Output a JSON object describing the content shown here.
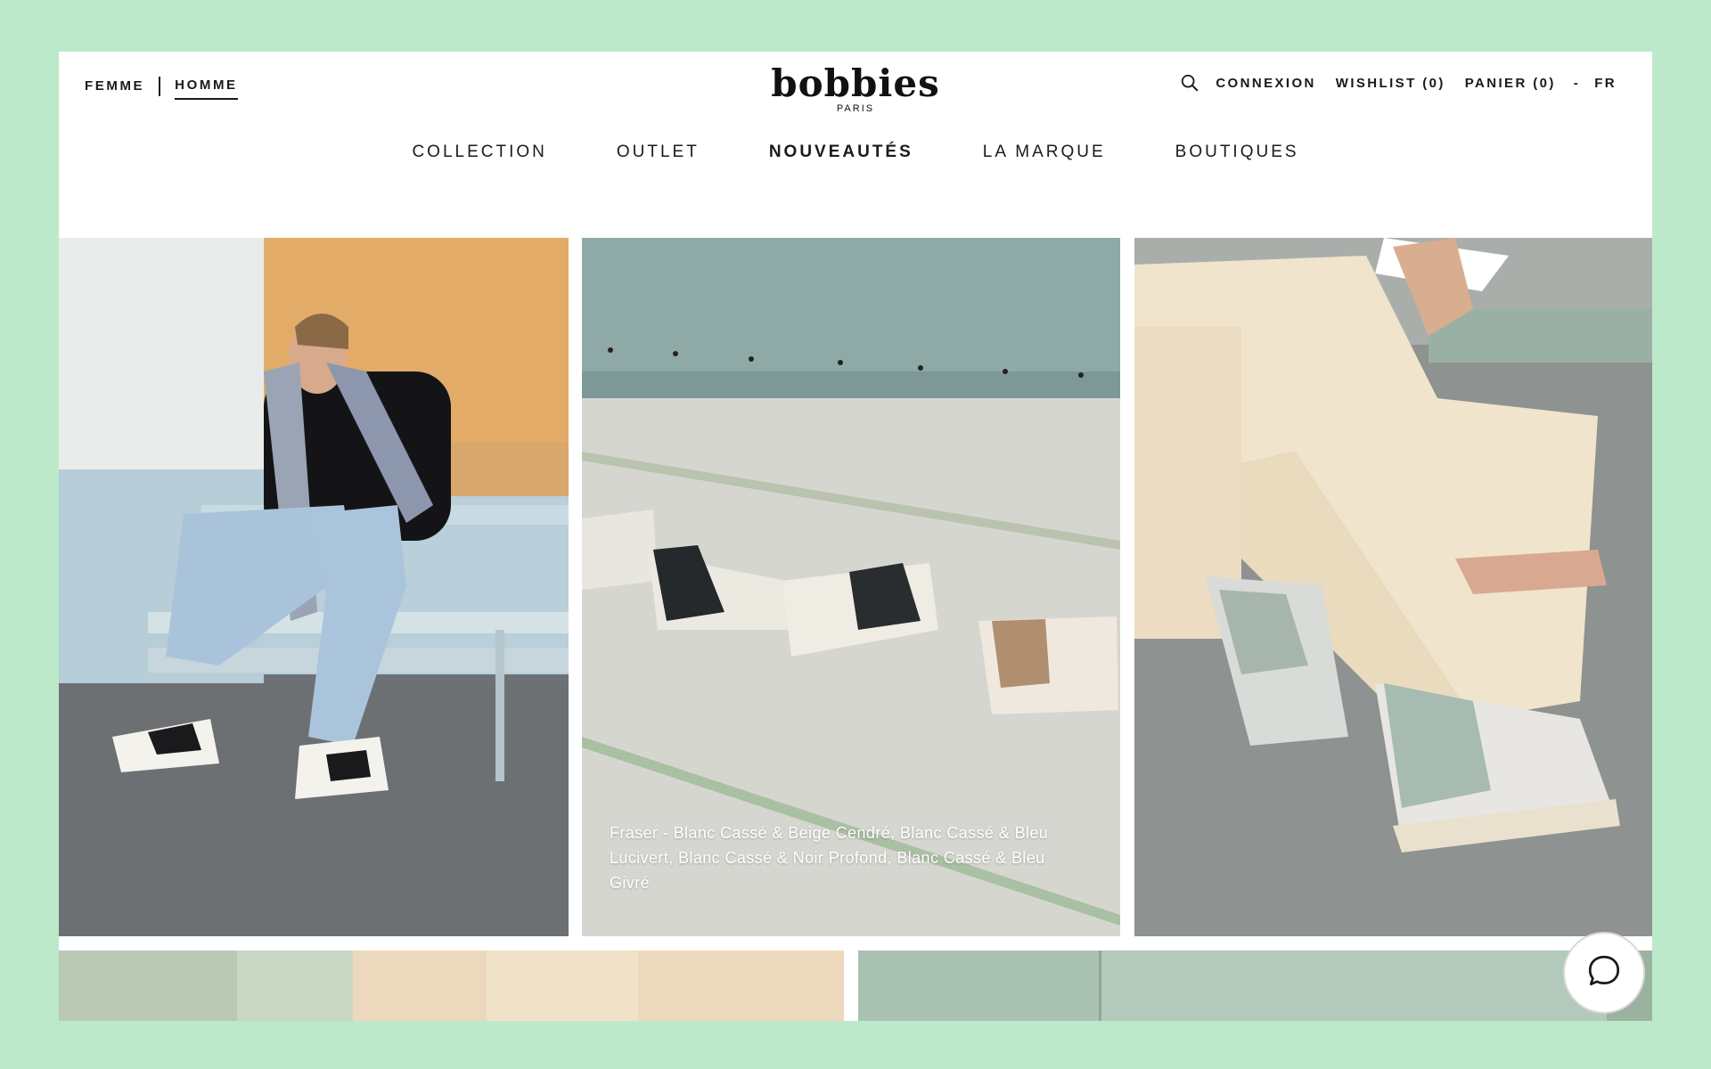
{
  "gender_nav": {
    "femme": "FEMME",
    "homme": "HOMME",
    "active": "HOMME"
  },
  "logo": {
    "wordmark": "bobbies",
    "tagline": "PARIS"
  },
  "utility_nav": {
    "search_icon": "search-icon",
    "connexion": "CONNEXION",
    "wishlist": "WISHLIST (0)",
    "panier": "PANIER (0)",
    "separator": "-",
    "language": "FR"
  },
  "main_nav": {
    "collection": "COLLECTION",
    "outlet": "OUTLET",
    "nouveautes": "NOUVEAUTÉS",
    "la_marque": "LA MARQUE",
    "boutiques": "BOUTIQUES"
  },
  "tiles": {
    "middle_caption": "Fraser - Blanc Cassé & Beige Cendré, Blanc Cassé & Bleu Lucivert, Blanc Cassé & Noir Profond, Blanc Cassé & Bleu Givré"
  },
  "chat": {
    "icon": "chat-bubble-icon"
  },
  "colors": {
    "background": "#bde9cb",
    "panel": "#ffffff",
    "text": "#1a1a1a"
  }
}
